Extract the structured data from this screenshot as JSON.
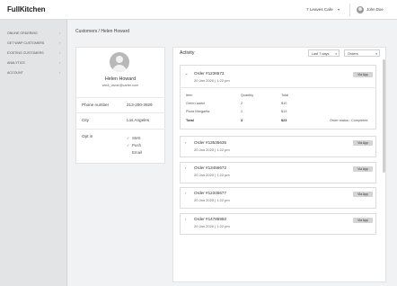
{
  "app": {
    "logo": "FullKitchen",
    "store_name": "7 Leaves Cafe",
    "user_name": "John Doe"
  },
  "sidebar": {
    "items": [
      {
        "label": "Online Ordering"
      },
      {
        "label": "Get WWP Customers"
      },
      {
        "label": "Existing Customers"
      },
      {
        "label": "Analytics"
      },
      {
        "label": "Account"
      }
    ]
  },
  "breadcrumb": "Customers / Helen Howard",
  "profile": {
    "name": "Helen Howard",
    "email": "wedi_lavoir@carter.com",
    "phone_label": "Phone number",
    "phone": "213-200-3929",
    "city_label": "City",
    "city": "Los Angeles",
    "optin_label": "Opt in",
    "optins": [
      {
        "label": "SMS",
        "checked": true
      },
      {
        "label": "Push",
        "checked": true
      },
      {
        "label": "Email",
        "checked": false
      }
    ]
  },
  "activity": {
    "title": "Activity",
    "range_select": "Last 7 days",
    "type_select": "Orders",
    "orders": [
      {
        "title": "Order #1236573",
        "date": "20 Jan 2020 | 1:22 pm",
        "badge": "Via App",
        "expanded": true
      },
      {
        "title": "Order #13535635",
        "date": "20 Jan 2020 | 1:22 pm",
        "badge": "Via App"
      },
      {
        "title": "Order #13456672",
        "date": "20 Jan 2020 | 1:22 pm",
        "badge": "Via App"
      },
      {
        "title": "Order #12345677",
        "date": "20 Jan 2020 | 1:22 pm",
        "badge": "Via App"
      },
      {
        "title": "Order #14785950",
        "date": "20 Jan 2020 | 1:22 pm",
        "badge": "Via App"
      }
    ],
    "detail": {
      "headers": [
        "Item",
        "Quantity",
        "Total"
      ],
      "rows": [
        {
          "item": "Green salad",
          "qty": "2",
          "total": "$10"
        },
        {
          "item": "Pizza Margarita",
          "qty": "1",
          "total": "$13"
        }
      ],
      "total_label": "Total",
      "total_qty": "3",
      "total_value": "$23",
      "status": "Order status : Completed"
    }
  }
}
